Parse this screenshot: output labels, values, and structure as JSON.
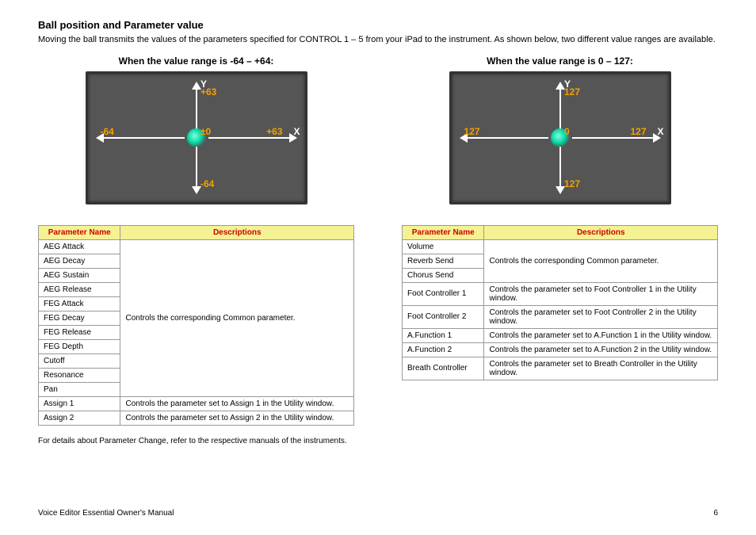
{
  "heading": "Ball position and Parameter value",
  "intro_text": "Moving the ball transmits the values of the parameters specified for CONTROL 1 – 5 from your iPad to the instrument. As shown below, two different value ranges are available.",
  "left": {
    "subhead": "When the value range is -64 – +64:",
    "pad": {
      "y_axis": "Y",
      "x_axis": "X",
      "top": "+63",
      "right": "+63",
      "bottom": "-64",
      "left": "-64",
      "center": "±0"
    },
    "table": {
      "col_param": "Parameter Name",
      "col_desc": "Descriptions",
      "rows": [
        {
          "name": "AEG Attack"
        },
        {
          "name": "AEG Decay"
        },
        {
          "name": "AEG Sustain"
        },
        {
          "name": "AEG Release"
        },
        {
          "name": "FEG Attack"
        },
        {
          "name": "FEG Decay"
        },
        {
          "name": "FEG Release"
        },
        {
          "name": "FEG Depth"
        },
        {
          "name": "Cutoff"
        },
        {
          "name": "Resonance"
        },
        {
          "name": "Pan"
        },
        {
          "name": "Assign 1",
          "desc": "Controls the parameter set to Assign 1 in the Utility window."
        },
        {
          "name": "Assign 2",
          "desc": "Controls the parameter set to Assign 2 in the Utility window."
        }
      ],
      "shared_desc": "Controls the corresponding Common parameter.",
      "shared_span": 11
    }
  },
  "right": {
    "subhead": "When the value range is 0 – 127:",
    "pad": {
      "y_axis": "Y",
      "x_axis": "X",
      "top": "127",
      "right": "127",
      "bottom": "127",
      "left": "127",
      "center": "0"
    },
    "table": {
      "col_param": "Parameter Name",
      "col_desc": "Descriptions",
      "rows": [
        {
          "name": "Volume"
        },
        {
          "name": "Reverb Send"
        },
        {
          "name": "Chorus Send"
        },
        {
          "name": "Foot Controller 1",
          "desc": "Controls the parameter set to Foot Controller 1 in the Utility window."
        },
        {
          "name": "Foot Controller 2",
          "desc": "Controls the parameter set to Foot Controller 2 in the Utility window."
        },
        {
          "name": "A.Function 1",
          "desc": "Controls the parameter set to A.Function 1 in the Utility window."
        },
        {
          "name": "A.Function 2",
          "desc": "Controls the parameter set to A.Function 2 in the Utility window."
        },
        {
          "name": "Breath Controller",
          "desc": "Controls the parameter set to Breath Controller in the Utility window."
        }
      ],
      "shared_desc": "Controls the corresponding Common parameter.",
      "shared_span": 3
    }
  },
  "note": "For details about Parameter Change, refer to the respective manuals of the instruments.",
  "footer_left": "Voice Editor Essential Owner's Manual",
  "footer_right": "6"
}
